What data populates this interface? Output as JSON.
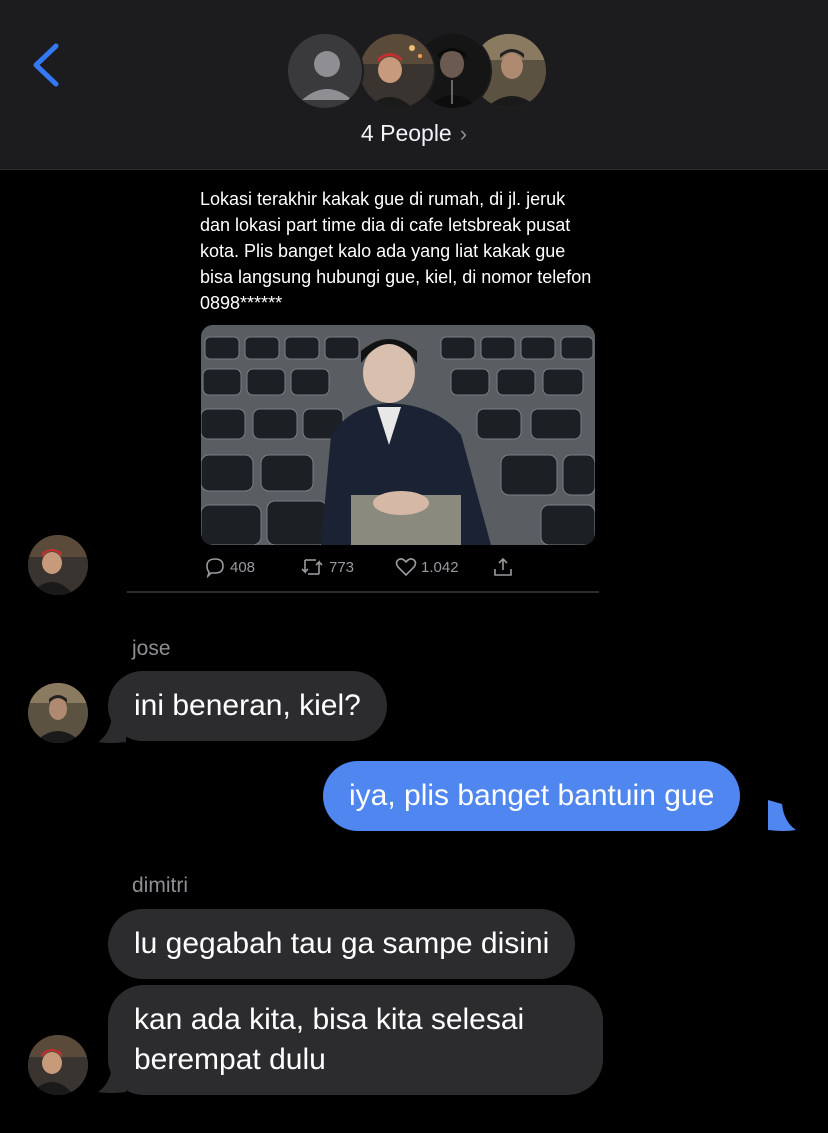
{
  "header": {
    "back_icon": "chevron-left-icon",
    "people_label": "4 People",
    "people_chevron": "›"
  },
  "tweet": {
    "text": "Lokasi terakhir kakak gue di rumah, di jl. jeruk dan lokasi part time dia di cafe letsbreak pusat kota. Plis banget kalo ada yang liat kakak gue bisa langsung hubungi gue, kiel, di nomor telefon 0898******",
    "replies": "408",
    "retweets": "773",
    "likes": "1.042"
  },
  "messages": [
    {
      "sender": "jose",
      "text": "ini beneran, kiel?"
    },
    {
      "sender": "me",
      "text": "iya, plis banget bantuin gue"
    },
    {
      "sender": "dimitri",
      "text": "lu gegabah tau ga sampe disini"
    },
    {
      "sender": "dimitri",
      "text_line1": "kan ada kita, bisa kita selesai",
      "text_line2": "berempat dulu"
    }
  ],
  "colors": {
    "background": "#000000",
    "header_bg": "#1c1c1e",
    "incoming_bubble": "#2c2c2e",
    "outgoing_bubble": "#4f86f0",
    "accent": "#3478f6",
    "sender_name": "#8e8e93"
  }
}
